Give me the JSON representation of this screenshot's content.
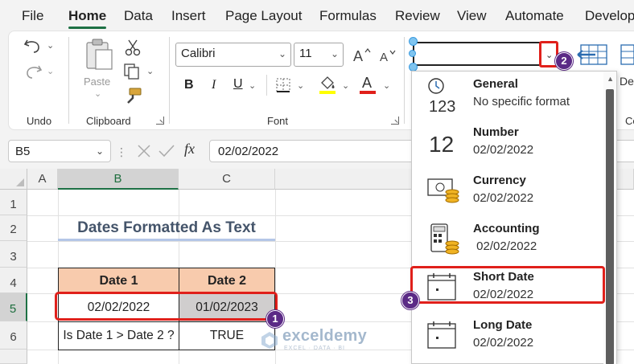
{
  "menu": {
    "items": [
      "File",
      "Home",
      "Data",
      "Insert",
      "Page Layout",
      "Formulas",
      "Review",
      "View",
      "Automate",
      "Develop"
    ],
    "active": "Home"
  },
  "ribbon": {
    "groups": {
      "undo": "Undo",
      "clipboard": "Clipboard",
      "font": "Font",
      "cells_partial": "Ce"
    },
    "paste_label": "Paste",
    "font_name": "Calibri",
    "font_size": "11",
    "bold": "B",
    "italic": "I",
    "underline": "U",
    "font_color_letter": "A",
    "delete_partial": "De",
    "fx_label": "fx",
    "highlight_color": "#ffff00",
    "font_color": "#e0201b",
    "accent_color": "#1e7145"
  },
  "formula_bar": {
    "name_box": "B5",
    "value": "02/02/2022"
  },
  "grid": {
    "columns": [
      "A",
      "B",
      "C"
    ],
    "rows": [
      "1",
      "2",
      "3",
      "4",
      "5",
      "6"
    ],
    "selected_column": "B",
    "selected_row": "5",
    "title": "Dates  Formatted As Text",
    "table": {
      "headers": [
        "Date 1",
        "Date 2"
      ],
      "row5": [
        "02/02/2022",
        "01/02/2023"
      ],
      "row6": [
        "Is Date 1 > Date 2 ?",
        "TRUE"
      ]
    },
    "header_fill": "#f8cbad",
    "gray_fill": "#d0cece"
  },
  "number_format_menu": {
    "items": [
      {
        "name": "General",
        "sample": "No specific format",
        "icon": "clock-123-icon"
      },
      {
        "name": "Number",
        "sample": "02/02/2022",
        "icon": "number-12-icon"
      },
      {
        "name": "Currency",
        "sample": "02/02/2022",
        "icon": "currency-icon"
      },
      {
        "name": "Accounting",
        "sample": " 02/02/2022",
        "icon": "accounting-icon"
      },
      {
        "name": "Short Date",
        "sample": "02/02/2022",
        "icon": "short-date-calendar-icon"
      },
      {
        "name": "Long Date",
        "sample": "02/02/2022",
        "icon": "long-date-calendar-icon"
      }
    ],
    "number_glyph": "12",
    "general_glyph": "123"
  },
  "badges": [
    "1",
    "2",
    "3"
  ],
  "watermark": {
    "name": "exceldemy",
    "tagline": "EXCEL · DATA · BI"
  }
}
